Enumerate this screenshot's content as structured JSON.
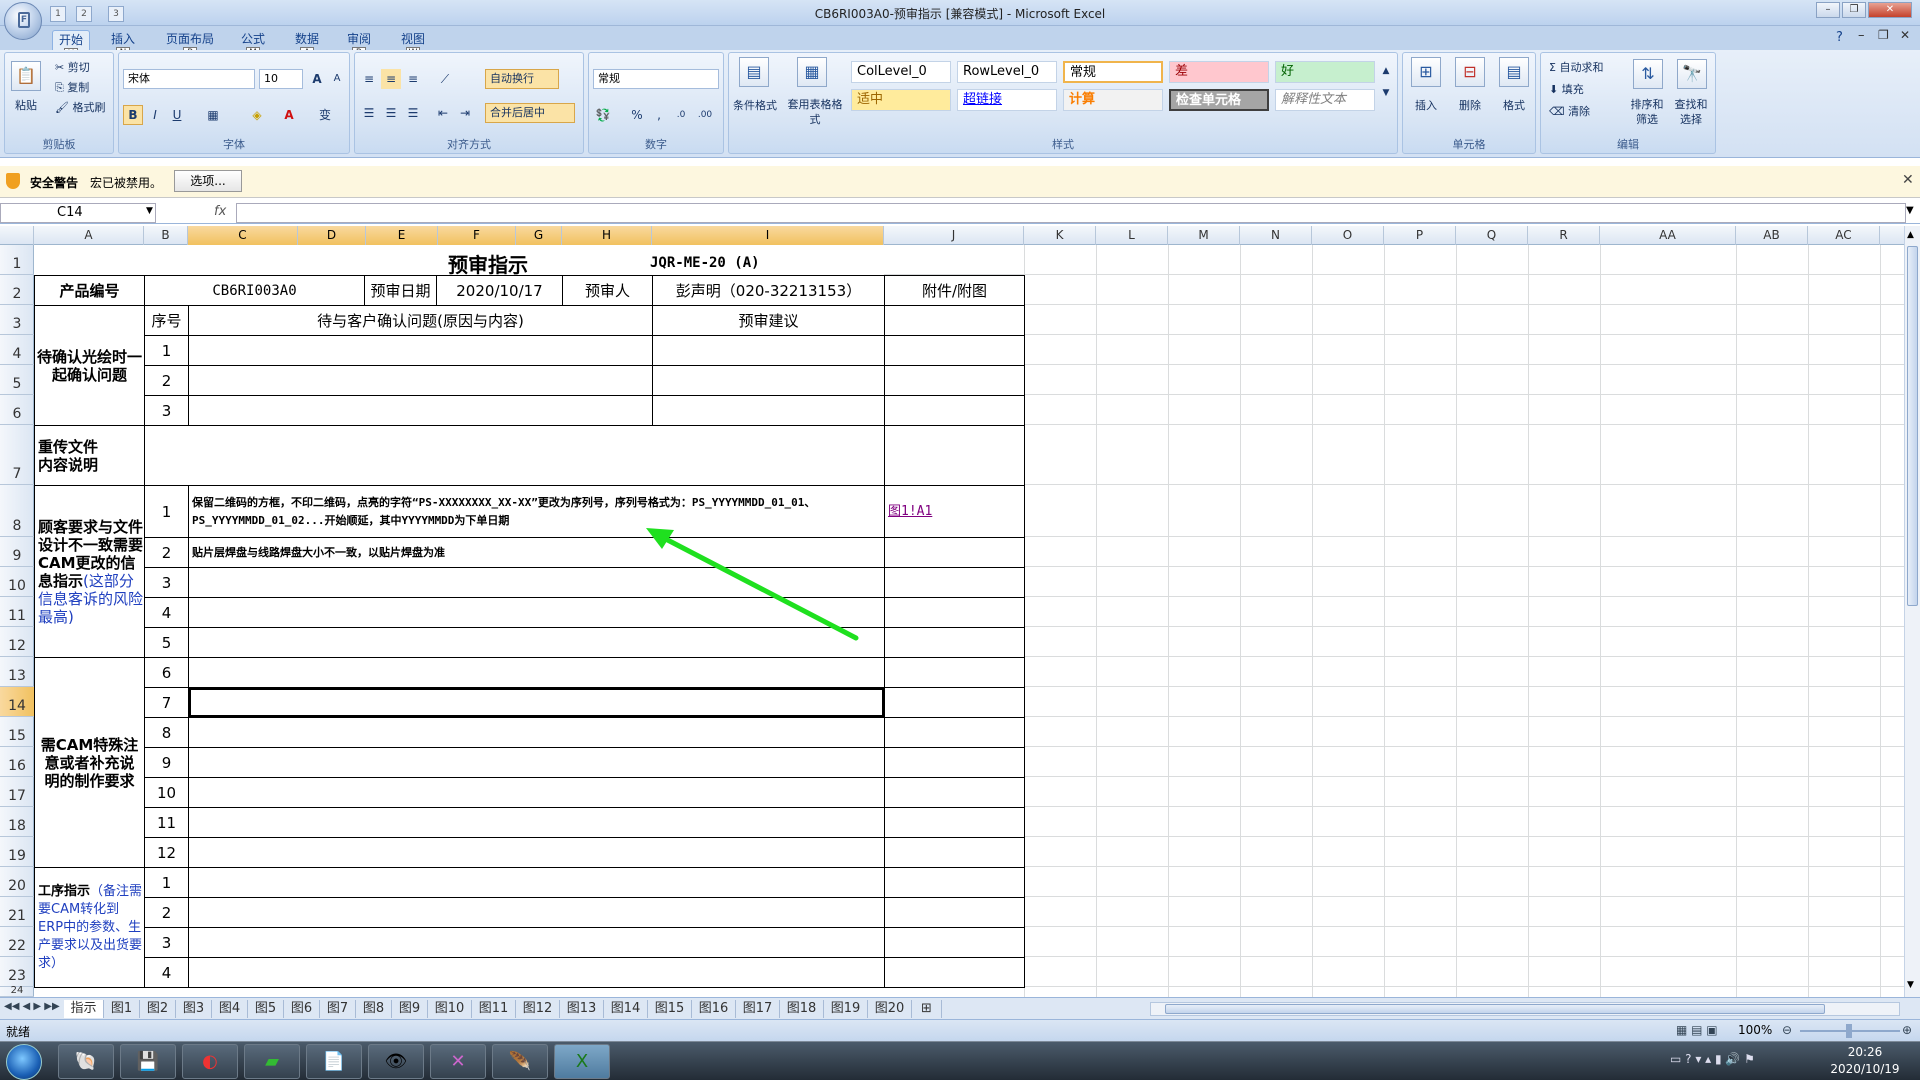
{
  "window": {
    "title": "CB6RI003A0-预审指示  [兼容模式] - Microsoft Excel",
    "qat": [
      "1",
      "2",
      "3"
    ]
  },
  "ribbon": {
    "tabs": [
      {
        "label": "开始",
        "key": "H"
      },
      {
        "label": "插入",
        "key": "N"
      },
      {
        "label": "页面布局",
        "key": "P"
      },
      {
        "label": "公式",
        "key": "M"
      },
      {
        "label": "数据",
        "key": "A"
      },
      {
        "label": "审阅",
        "key": "R"
      },
      {
        "label": "视图",
        "key": "W"
      }
    ],
    "clipboard": {
      "paste": "粘贴",
      "cut": "剪切",
      "copy": "复制",
      "format_painter": "格式刷",
      "label": "剪贴板"
    },
    "font": {
      "name": "宋体",
      "size": "10",
      "label": "字体",
      "bold": "B",
      "italic": "I",
      "underline": "U",
      "grow": "A",
      "shrink": "A",
      "color": "A",
      "wen": "变"
    },
    "alignment": {
      "wrap": "自动换行",
      "merge": "合并后居中",
      "label": "对齐方式"
    },
    "number": {
      "format": "常规",
      "percent": "%",
      "comma": ",",
      "inc": ".0",
      "dec": ".00",
      "label": "数字"
    },
    "styles": {
      "cond": "条件格式",
      "table": "套用表格格式",
      "cells": [
        "ColLevel_0",
        "RowLevel_0",
        "常规",
        "差",
        "好",
        "适中",
        "超链接",
        "计算",
        "检查单元格",
        "解释性文本"
      ],
      "label": "样式"
    },
    "cells_group": {
      "insert": "插入",
      "delete": "删除",
      "format": "格式",
      "label": "单元格"
    },
    "editing": {
      "autosum": "自动求和",
      "fill": "填充",
      "clear": "清除",
      "sort": "排序和筛选",
      "find": "查找和选择",
      "label": "编辑"
    }
  },
  "security": {
    "title": "安全警告",
    "message": "宏已被禁用。",
    "options": "选项..."
  },
  "formula_bar": {
    "name_box": "C14",
    "fx": "fx",
    "content": ""
  },
  "columns": [
    "A",
    "B",
    "C",
    "D",
    "E",
    "F",
    "G",
    "H",
    "I",
    "J",
    "K",
    "L",
    "M",
    "N",
    "O",
    "P",
    "Q",
    "R",
    "AA",
    "AB",
    "AC"
  ],
  "rows": [
    "1",
    "2",
    "3",
    "4",
    "5",
    "6",
    "7",
    "8",
    "9",
    "10",
    "11",
    "12",
    "13",
    "14",
    "15",
    "16",
    "17",
    "18",
    "19",
    "20",
    "21",
    "22",
    "23",
    "24"
  ],
  "sheet": {
    "title": "预审指示",
    "code": "JQR-ME-20 (A)",
    "product_no_label": "产品编号",
    "product_no": "CB6RI003A0",
    "date_label": "预审日期",
    "date": "2020/10/17",
    "reviewer_label": "预审人",
    "reviewer": "彭声明（020-32213153）",
    "attach_label": "附件/附图",
    "seq_label": "序号",
    "issue_label": "待与客户确认问题(原因与内容)",
    "advice_label": "预审建议",
    "sec1": "待确认光绘时一起确认问题",
    "sec2": "重传文件内容说明",
    "sec3_a": "顾客要求与文件设计不一致需要CAM更改的信息指示",
    "sec3_b": "(这部分信息客诉的风险最高)",
    "sec4": "需CAM特殊注意或者补充说明的制作要求",
    "sec5_a": "工序指示",
    "sec5_b": "（备注需要CAM转化到ERP中的参数、生产要求以及出货要求）",
    "item1": "保留二维码的方框，不印二维码，点亮的字符“PS-XXXXXXXX_XX-XX”更改为序列号，序列号格式为：PS_YYYYMMDD_01_01、PS_YYYYMMDD_01_02...开始顺延，其中YYYYMMDD为下单日期",
    "item1_link": "图1!A1",
    "item2": "贴片层焊盘与线路焊盘大小不一致，以贴片焊盘为准",
    "seq": [
      "1",
      "2",
      "3",
      "1",
      "2",
      "3",
      "4",
      "5",
      "6",
      "7",
      "8",
      "9",
      "10",
      "11",
      "12",
      "1",
      "2",
      "3",
      "4"
    ]
  },
  "sheet_tabs": [
    "指示",
    "图1",
    "图2",
    "图3",
    "图4",
    "图5",
    "图6",
    "图7",
    "图8",
    "图9",
    "图10",
    "图11",
    "图12",
    "图13",
    "图14",
    "图15",
    "图16",
    "图17",
    "图18",
    "图19",
    "图20"
  ],
  "status": {
    "ready": "就绪",
    "zoom": "100%"
  },
  "taskbar": {
    "time": "20:26",
    "date": "2020/10/19"
  }
}
